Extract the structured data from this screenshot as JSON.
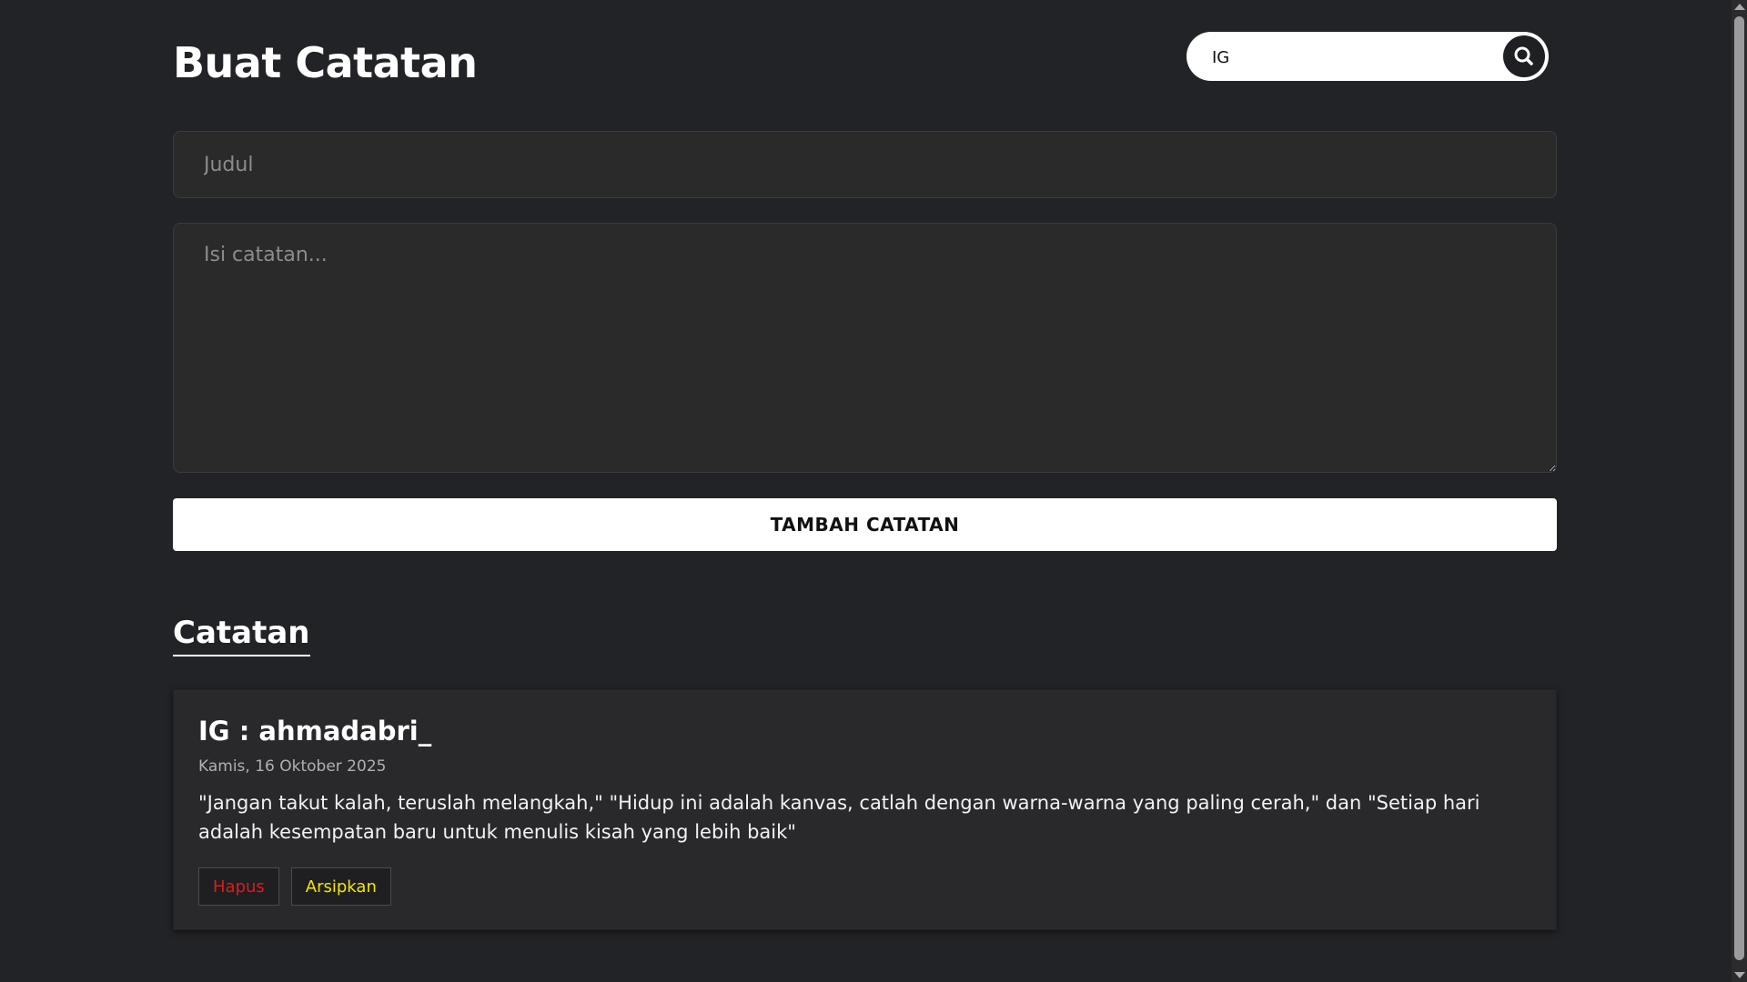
{
  "header": {
    "title": "Buat Catatan",
    "search": {
      "value": "IG",
      "placeholder": "",
      "icon": "search-icon"
    }
  },
  "form": {
    "title_placeholder": "Judul",
    "body_placeholder": "Isi catatan...",
    "submit_label": "TAMBAH CATATAN"
  },
  "notes_section": {
    "title": "Catatan",
    "notes": [
      {
        "title": "IG : ahmadabri_",
        "date": "Kamis, 16 Oktober 2025",
        "body": "\"Jangan takut kalah, teruslah melangkah,\" \"Hidup ini adalah kanvas, catlah dengan warna-warna yang paling cerah,\" dan \"Setiap hari adalah kesempatan baru untuk menulis kisah yang lebih baik\"",
        "delete_label": "Hapus",
        "archive_label": "Arsipkan"
      }
    ]
  },
  "colors": {
    "background": "#222326",
    "delete": "#e21a1a",
    "archive": "#f2e600"
  }
}
